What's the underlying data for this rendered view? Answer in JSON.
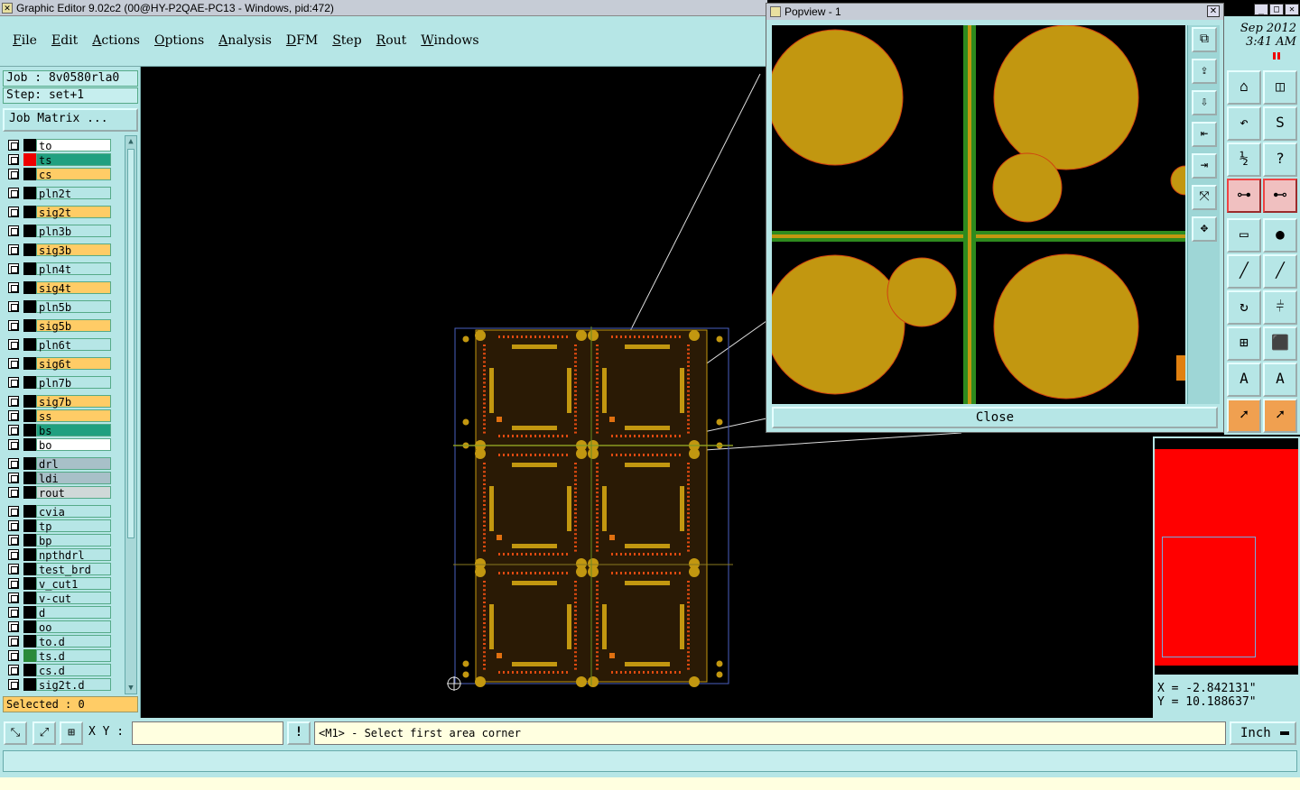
{
  "window": {
    "title": "Graphic Editor 9.02c2 (00@HY-P2QAE-PC13 - Windows, pid:472)"
  },
  "menu": [
    "File",
    "Edit",
    "Actions",
    "Options",
    "Analysis",
    "DFM",
    "Step",
    "Rout",
    "Windows"
  ],
  "job": {
    "job_label": "Job : 8v0580rla0",
    "step_label": "Step: set+1",
    "matrix_button": "Job Matrix ..."
  },
  "layers": [
    {
      "name": "to",
      "color": "#ffffff",
      "swatch": "#000000"
    },
    {
      "name": "ts",
      "color": "#20a080",
      "swatch": "#ee0000"
    },
    {
      "name": "cs",
      "color": "#ffcc66",
      "swatch": "#000000"
    },
    {
      "name": "pln2t",
      "color": "#b6e6e6",
      "swatch": "#000000"
    },
    {
      "name": "sig2t",
      "color": "#ffcc66",
      "swatch": "#000000"
    },
    {
      "name": "pln3b",
      "color": "#b6e6e6",
      "swatch": "#000000"
    },
    {
      "name": "sig3b",
      "color": "#ffcc66",
      "swatch": "#000000"
    },
    {
      "name": "pln4t",
      "color": "#b6e6e6",
      "swatch": "#000000"
    },
    {
      "name": "sig4t",
      "color": "#ffcc66",
      "swatch": "#000000"
    },
    {
      "name": "pln5b",
      "color": "#b6e6e6",
      "swatch": "#000000"
    },
    {
      "name": "sig5b",
      "color": "#ffcc66",
      "swatch": "#000000"
    },
    {
      "name": "pln6t",
      "color": "#b6e6e6",
      "swatch": "#000000"
    },
    {
      "name": "sig6t",
      "color": "#ffcc66",
      "swatch": "#000000"
    },
    {
      "name": "pln7b",
      "color": "#b6e6e6",
      "swatch": "#000000"
    },
    {
      "name": "sig7b",
      "color": "#ffcc66",
      "swatch": "#000000"
    },
    {
      "name": "ss",
      "color": "#ffcc66",
      "swatch": "#000000"
    },
    {
      "name": "bs",
      "color": "#20a080",
      "swatch": "#000000"
    },
    {
      "name": "bo",
      "color": "#ffffff",
      "swatch": "#000000"
    },
    {
      "name": "drl",
      "color": "#a8c0c8",
      "swatch": "#000000"
    },
    {
      "name": "ldi",
      "color": "#a8c0c8",
      "swatch": "#000000"
    },
    {
      "name": "rout",
      "color": "#d0d8d8",
      "swatch": "#000000"
    },
    {
      "name": "cvia",
      "color": "#b6e6e6",
      "swatch": "#000000"
    },
    {
      "name": "tp",
      "color": "#b6e6e6",
      "swatch": "#000000"
    },
    {
      "name": "bp",
      "color": "#b6e6e6",
      "swatch": "#000000"
    },
    {
      "name": "npthdrl",
      "color": "#b6e6e6",
      "swatch": "#000000"
    },
    {
      "name": "test_brd",
      "color": "#b6e6e6",
      "swatch": "#000000"
    },
    {
      "name": "v_cut1",
      "color": "#b6e6e6",
      "swatch": "#000000"
    },
    {
      "name": "v-cut",
      "color": "#b6e6e6",
      "swatch": "#000000"
    },
    {
      "name": "d",
      "color": "#b6e6e6",
      "swatch": "#000000"
    },
    {
      "name": "oo",
      "color": "#b6e6e6",
      "swatch": "#000000"
    },
    {
      "name": "to.d",
      "color": "#b6e6e6",
      "swatch": "#000000"
    },
    {
      "name": "ts.d",
      "color": "#b6e6e6",
      "swatch": "#2a8a3a"
    },
    {
      "name": "cs.d",
      "color": "#b6e6e6",
      "swatch": "#000000"
    },
    {
      "name": "sig2t.d",
      "color": "#b6e6e6",
      "swatch": "#000000"
    }
  ],
  "selected": "Selected : 0",
  "popview": {
    "title": "Popview - 1",
    "close_label": "Close"
  },
  "clock": {
    "date": "Sep 2012",
    "time": "3:41 AM"
  },
  "coords": {
    "x": "X = -2.842131\"",
    "y": "Y = 10.188637\""
  },
  "bottom": {
    "xy_label": "X Y :",
    "xy_value": "",
    "prompt": "<M1> - Select first area corner",
    "unit": "Inch",
    "warn": "!"
  },
  "colors": {
    "copper": "#c29710",
    "panel": "#b6e6e6",
    "green_line": "#2e8b1e",
    "overview": "#ff0000"
  }
}
